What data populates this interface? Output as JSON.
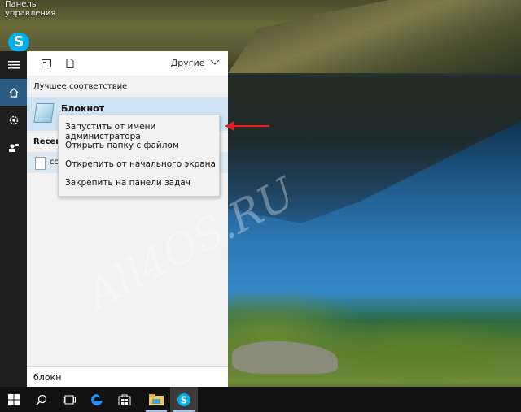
{
  "desktop": {
    "shortcut_label": "Панель управления",
    "skype_label": "S"
  },
  "watermark": "All4OS.RU",
  "start_panel": {
    "others_label": "Другие",
    "best_match_label": "Лучшее соответствие",
    "best_match_title": "Блокнот",
    "recent_label": "Recent",
    "recent_item": "co",
    "search_value": "блокн"
  },
  "context_menu": {
    "items": [
      "Запустить от имени администратора",
      "Открыть папку с файлом",
      "Открепить от начального экрана",
      "Закрепить на панели задач"
    ]
  },
  "colors": {
    "accent": "#2b5c85",
    "arrow": "#e02424",
    "highlight": "#cfe3f4"
  },
  "taskbar": {
    "icons": [
      "windows-start-icon",
      "search-icon",
      "task-view-icon",
      "edge-icon",
      "store-icon",
      "file-explorer-icon",
      "skype-icon"
    ]
  }
}
